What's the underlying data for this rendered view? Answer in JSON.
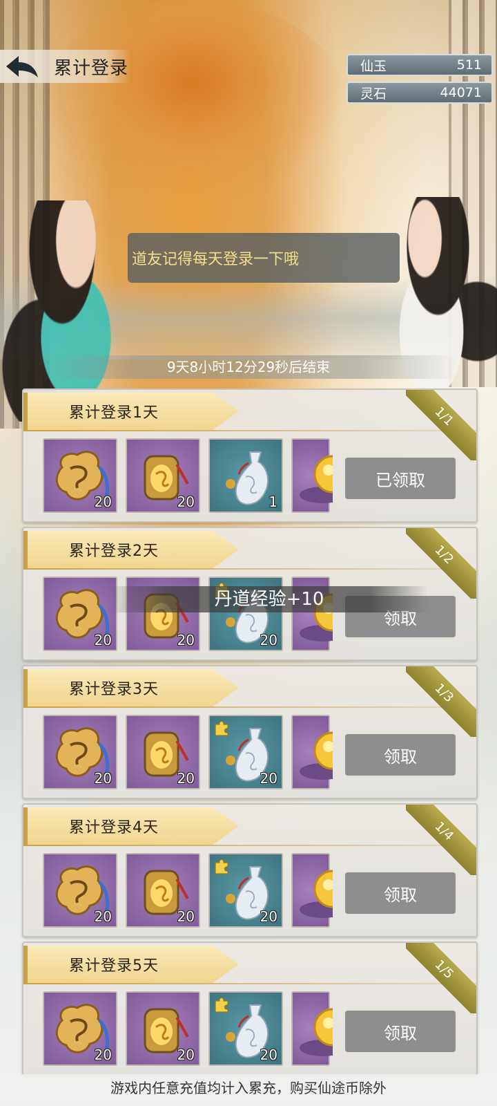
{
  "header": {
    "title": "累计登录"
  },
  "currency": [
    {
      "name": "仙玉",
      "value": "511"
    },
    {
      "name": "灵石",
      "value": "44071"
    }
  ],
  "tip": "道友记得每天登录一下哦",
  "countdown": "9天8小时12分29秒后结束",
  "toast": "丹道经验+10",
  "footer_note": "游戏内任意充值均计入累充，购买仙途币除外",
  "cards": [
    {
      "title": "累计登录1天",
      "progress": "1/1",
      "button": "已领取",
      "items": [
        "20",
        "20",
        "1"
      ]
    },
    {
      "title": "累计登录2天",
      "progress": "1/2",
      "button": "领取",
      "items": [
        "20",
        "20",
        "20"
      ]
    },
    {
      "title": "累计登录3天",
      "progress": "1/3",
      "button": "领取",
      "items": [
        "20",
        "20",
        "20"
      ]
    },
    {
      "title": "累计登录4天",
      "progress": "1/4",
      "button": "领取",
      "items": [
        "20",
        "20",
        "20"
      ]
    },
    {
      "title": "累计登录5天",
      "progress": "1/5",
      "button": "领取",
      "items": [
        "20",
        "20",
        "20"
      ]
    }
  ],
  "icons": {
    "back": "back-arrow-icon",
    "item1": "jade-token-icon",
    "item2": "gold-medallion-icon",
    "item3": "porcelain-vase-icon",
    "item4": "golden-orb-icon"
  }
}
